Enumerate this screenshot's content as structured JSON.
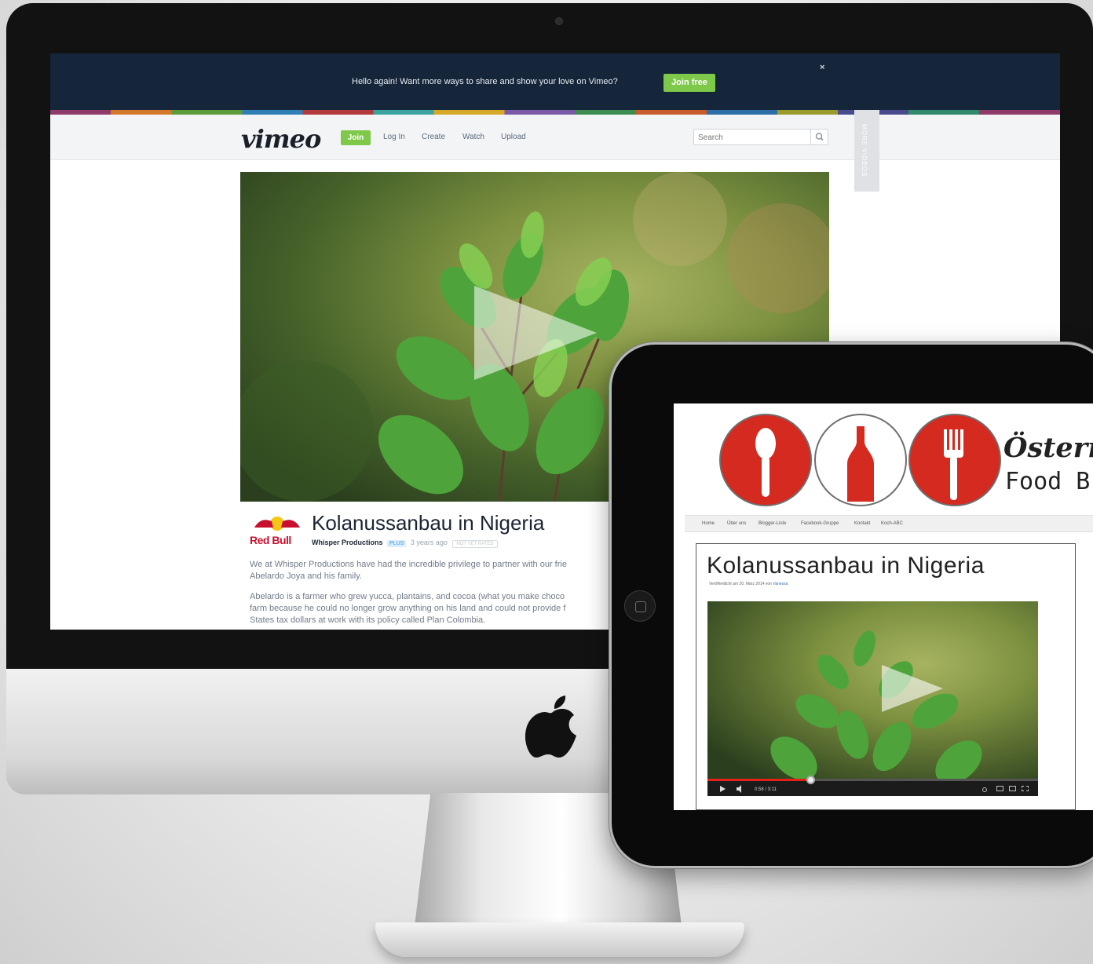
{
  "banner": {
    "text": "Hello again! Want more ways to share and show your love on Vimeo?",
    "join_label": "Join free",
    "close_glyph": "×"
  },
  "nav": {
    "logo": "vimeo",
    "join_label": "Join",
    "links": [
      "Log In",
      "Create",
      "Watch",
      "Upload"
    ],
    "search_placeholder": "Search",
    "side_tab_label": "MORE VIDEOS"
  },
  "video": {
    "brand_logo_text": "Red Bull",
    "title": "Kolanussanbau in Nigeria",
    "author": "Whisper Productions",
    "plus_badge": "PLUS",
    "age": "3 years ago",
    "rating_badge": "NOT YET RATED",
    "description": [
      "We at Whisper Productions have had the incredible privilege to partner with our frie",
      "Abelardo Joya and his family.",
      "Abelardo is a farmer who grew yucca, plantains, and cocoa (what you make choco",
      "farm because he could no longer grow anything on his land and could not provide f",
      "States tax dollars at work with its policy called Plan Colombia."
    ]
  },
  "tablet": {
    "blog_title": "Österrei",
    "blog_subtitle": "Food B",
    "nav_items": [
      "Home",
      "Über uns",
      "Blogger-Liste",
      "Facebook-Gruppe",
      "Kontakt",
      "Koch-ABC"
    ],
    "post_title": "Kolanussanbau in Nigeria",
    "post_meta": "Veröffentlicht am 20. März 2014 von",
    "post_author": "Vanessa",
    "player_time": "0:58 / 3:11",
    "progress": 0.31
  },
  "colors": {
    "banner_bg": "#15253a",
    "accent_green": "#7ec84a",
    "blog_red": "#d42a1f",
    "yt_red": "#e52117"
  }
}
